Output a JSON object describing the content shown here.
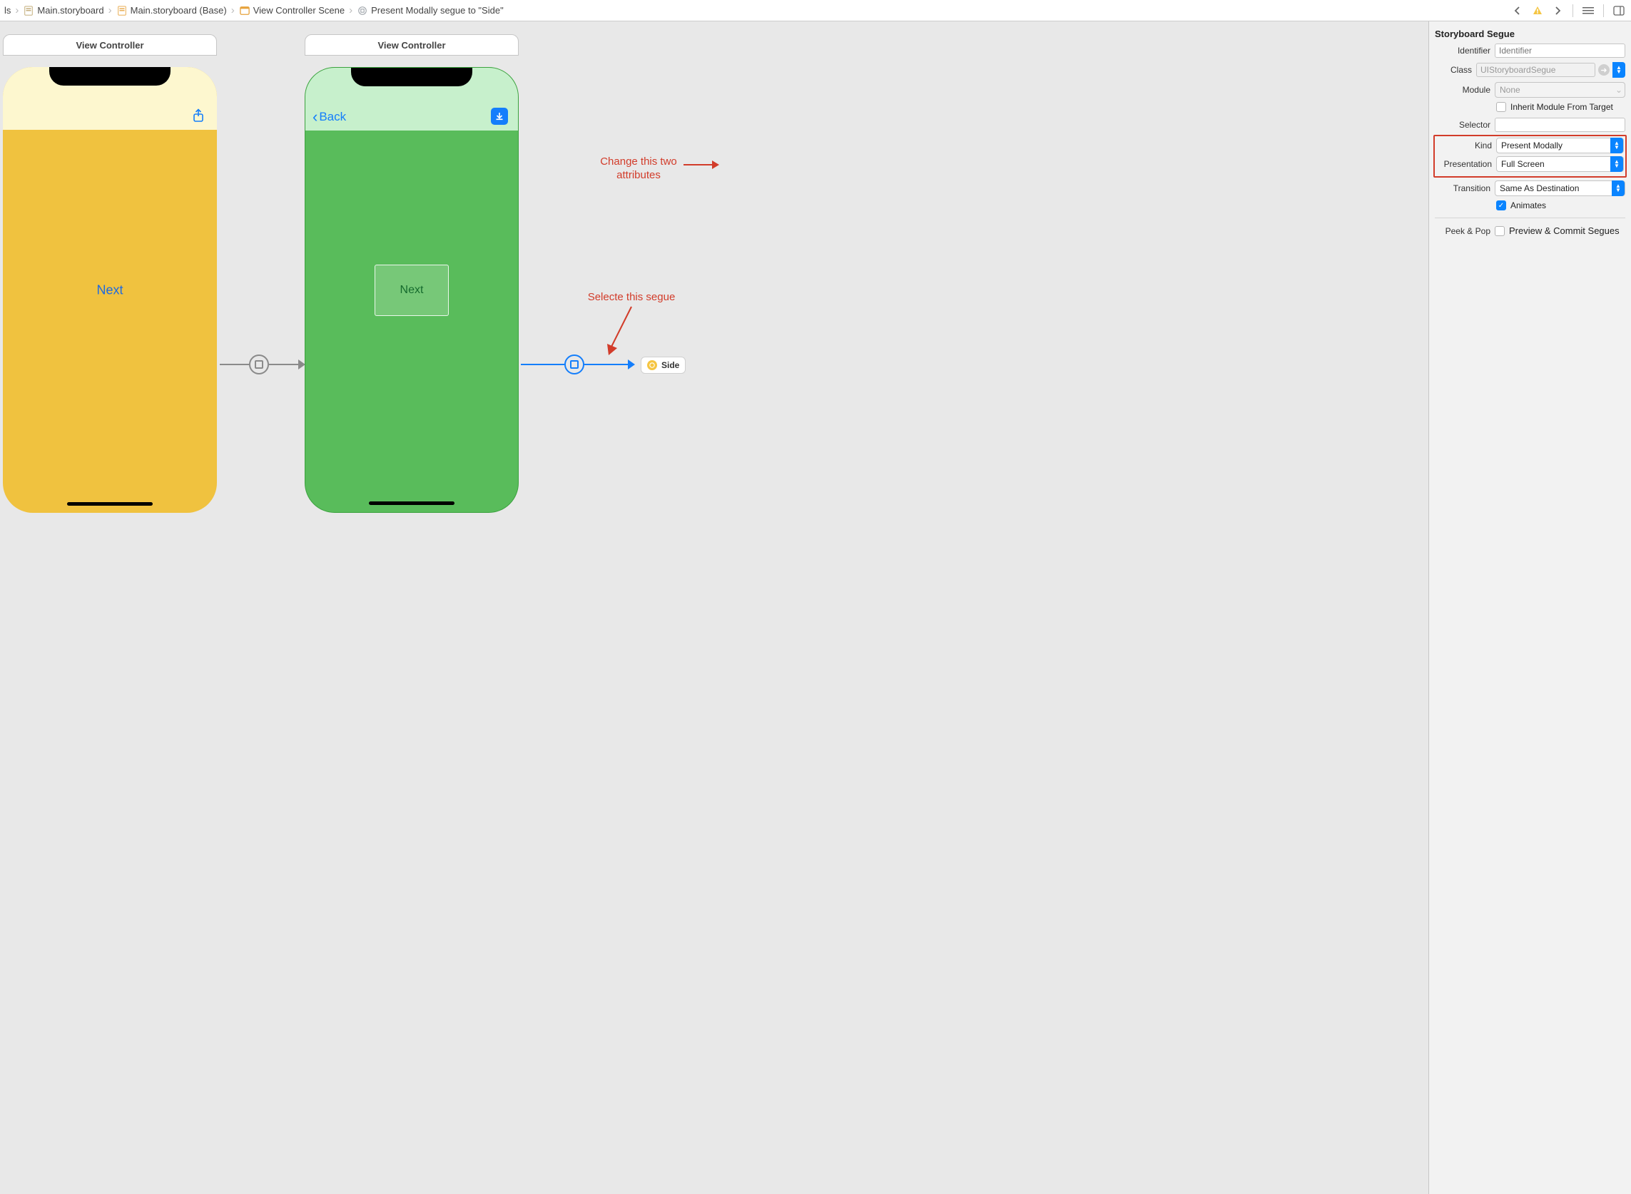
{
  "breadcrumbs": {
    "items": [
      {
        "label": "ls"
      },
      {
        "label": "Main.storyboard"
      },
      {
        "label": "Main.storyboard (Base)"
      },
      {
        "label": "View Controller Scene"
      },
      {
        "label": "Present Modally segue to \"Side\""
      }
    ]
  },
  "canvas": {
    "scene1": {
      "title": "View Controller",
      "next_label": "Next"
    },
    "scene2": {
      "title": "View Controller",
      "back_label": "Back",
      "next_label": "Next"
    },
    "ref_chip": {
      "label": "Side"
    }
  },
  "annotations": {
    "attrs": {
      "line1": "Change this two",
      "line2": "attributes"
    },
    "segue": "Selecte this segue"
  },
  "inspector": {
    "section_title": "Storyboard Segue",
    "identifier": {
      "label": "Identifier",
      "value": "",
      "placeholder": "Identifier"
    },
    "klass": {
      "label": "Class",
      "value": "UIStoryboardSegue"
    },
    "module": {
      "label": "Module",
      "value": "None"
    },
    "inherit": {
      "label": "Inherit Module From Target",
      "checked": false
    },
    "selector": {
      "label": "Selector",
      "value": ""
    },
    "kind": {
      "label": "Kind",
      "value": "Present Modally"
    },
    "presentation": {
      "label": "Presentation",
      "value": "Full Screen"
    },
    "transition": {
      "label": "Transition",
      "value": "Same As Destination"
    },
    "animates": {
      "label": "Animates",
      "checked": true
    },
    "peekpop": {
      "label": "Peek & Pop",
      "value_label": "Preview & Commit Segues",
      "checked": false
    }
  }
}
